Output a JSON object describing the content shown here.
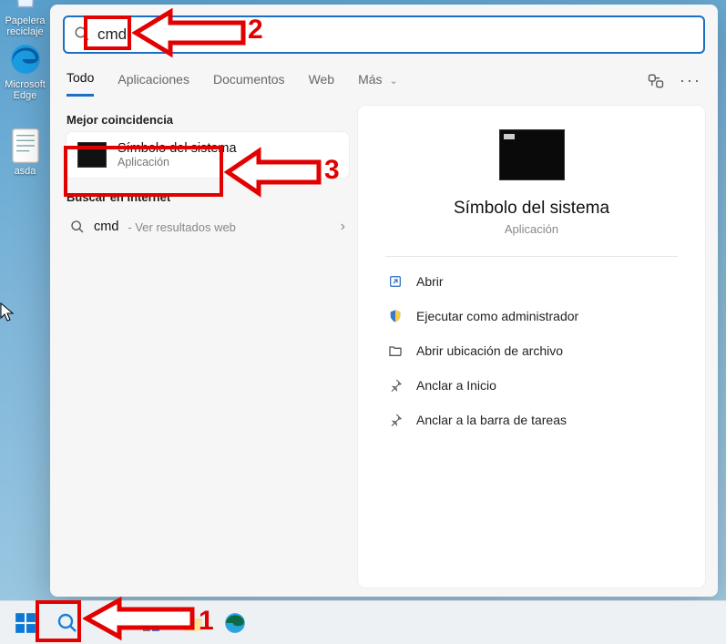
{
  "desktop": {
    "recycle_label": "Papelera reciclaje",
    "edge_label": "Microsoft Edge",
    "doc_label": "asda"
  },
  "search": {
    "value": "cmd",
    "tabs": {
      "todo": "Todo",
      "apps": "Aplicaciones",
      "docs": "Documentos",
      "web": "Web",
      "more": "Más"
    },
    "best_match_header": "Mejor coincidencia",
    "internet_header": "Buscar en Internet",
    "match": {
      "title": "Símbolo del sistema",
      "subtitle": "Aplicación"
    },
    "web": {
      "term": "cmd",
      "hint": " - Ver resultados web"
    },
    "preview": {
      "title": "Símbolo del sistema",
      "subtitle": "Aplicación"
    },
    "actions": {
      "open": "Abrir",
      "admin": "Ejecutar como administrador",
      "loc": "Abrir ubicación de archivo",
      "pin_start": "Anclar a Inicio",
      "pin_task": "Anclar a la barra de tareas"
    }
  },
  "annotations": {
    "n1": "1",
    "n2": "2",
    "n3": "3"
  }
}
